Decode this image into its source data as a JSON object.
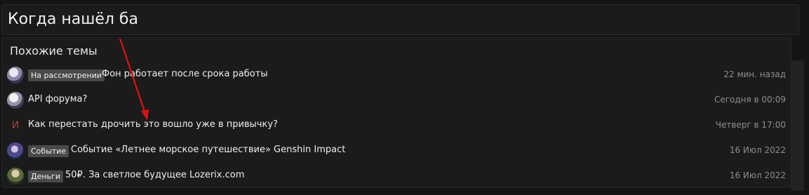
{
  "thread": {
    "title_input_value": "Когда нашёл ба"
  },
  "similar": {
    "heading": "Похожие темы",
    "items": [
      {
        "avatar": "user-avatar",
        "prefix": "На рассмотрении",
        "title": "Фон работает после срока работы",
        "date": "22 мин. назад"
      },
      {
        "avatar": "user-avatar",
        "prefix": "",
        "title": "API форума?",
        "date": "Сегодня в 00:09"
      },
      {
        "avatar": "letter-avatar",
        "avatar_letter": "И",
        "prefix": "",
        "title": "Как перестать дрочить это вошло уже в привычку?",
        "date": "Четверг в 17:00"
      },
      {
        "avatar": "user-avatar",
        "prefix": "Событие",
        "title": "Событие «Летнее морское путешествие» Genshin Impact",
        "date": "16 Июл 2022"
      },
      {
        "avatar": "user-avatar",
        "prefix": "Деньги",
        "title": "50₽. За светлое будущее Lozerix.com",
        "date": "16 Июл 2022"
      }
    ]
  },
  "annotation": {
    "arrow_color": "#e01010"
  }
}
